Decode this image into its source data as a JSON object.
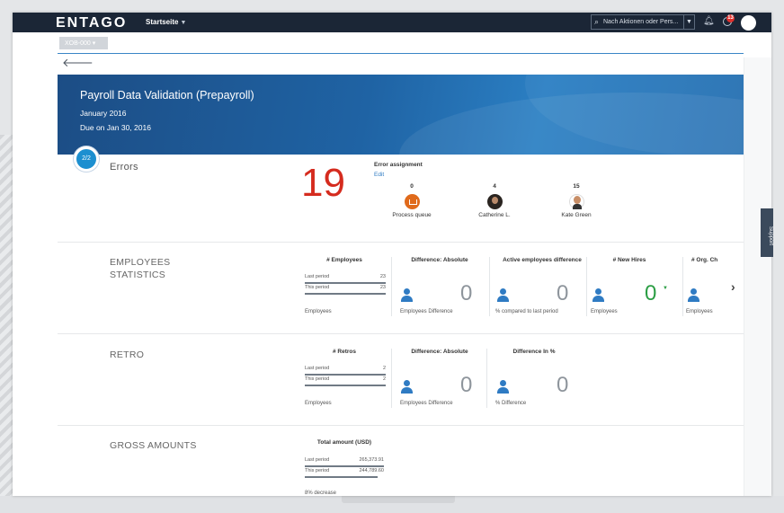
{
  "shell": {
    "logo": "ENTAGO",
    "home_menu": "Startseite",
    "search_placeholder": "Nach Aktionen oder Pers...",
    "notification_count": "13"
  },
  "subtab_label": "XOB-000",
  "banner": {
    "title": "Payroll Data Validation (Prepayroll)",
    "period": "January 2016",
    "due": "Due on Jan 30, 2016"
  },
  "step": "2/2",
  "errors": {
    "label": "Errors",
    "count": "19",
    "assignment_title": "Error assignment",
    "edit_label": "Edit",
    "assignees": [
      {
        "count": "0",
        "name": "Process queue"
      },
      {
        "count": "4",
        "name": "Catherine L."
      },
      {
        "count": "15",
        "name": "Kate Green"
      }
    ]
  },
  "employees_stats": {
    "label_line1": "EMPLOYEES",
    "label_line2": "STATISTICS",
    "count_kpi": {
      "title": "# Employees",
      "last_label": "Last period",
      "last_value": "23",
      "this_label": "This period",
      "this_value": "23",
      "footer": "Employees"
    },
    "diff_abs": {
      "title": "Difference: Absolute",
      "value": "0",
      "footer": "Employees Difference"
    },
    "active_diff": {
      "title": "Active employees difference",
      "value": "0",
      "footer": "% compared to last period"
    },
    "new_hires": {
      "title": "# New Hires",
      "value": "0",
      "footer": "Employees"
    },
    "org_changes": {
      "title": "# Org. Ch",
      "footer": "Employees"
    }
  },
  "retro": {
    "label": "RETRO",
    "count_kpi": {
      "title": "# Retros",
      "last_label": "Last period",
      "last_value": "2",
      "this_label": "This period",
      "this_value": "2",
      "footer": "Employees"
    },
    "diff_abs": {
      "title": "Difference: Absolute",
      "value": "0",
      "footer": "Employees Difference"
    },
    "diff_pct": {
      "title": "Difference In %",
      "value": "0",
      "footer": "% Difference"
    }
  },
  "gross": {
    "label": "GROSS AMOUNTS",
    "total_kpi": {
      "title": "Total amount (USD)",
      "last_label": "Last period",
      "last_value": "265,373.91",
      "this_label": "This period",
      "this_value": "244,789.60",
      "footer": "8% decrease"
    }
  },
  "support_label": "Support"
}
